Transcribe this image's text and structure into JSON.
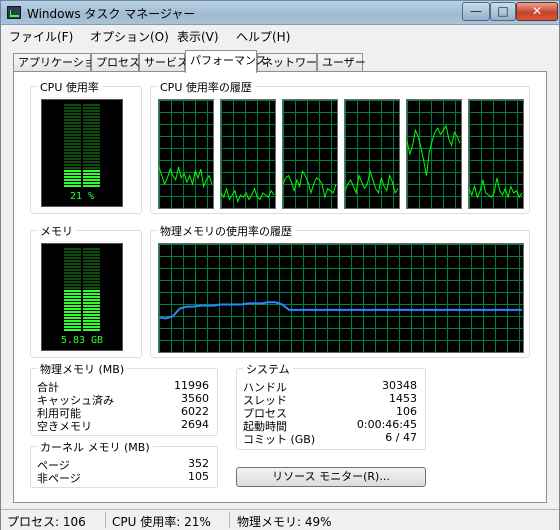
{
  "window": {
    "title": "Windows タスク マネージャー",
    "close_glyph": "✕",
    "minimize_glyph": "—",
    "maximize_glyph": "□"
  },
  "menu": [
    "ファイル(F)",
    "オプション(O)",
    "表示(V)",
    "ヘルプ(H)"
  ],
  "tabs": [
    {
      "label": "アプリケーション",
      "active": false
    },
    {
      "label": "プロセス",
      "active": false
    },
    {
      "label": "サービス",
      "active": false
    },
    {
      "label": "パフォーマンス",
      "active": true
    },
    {
      "label": "ネットワーク",
      "active": false
    },
    {
      "label": "ユーザー",
      "active": false
    }
  ],
  "cpu": {
    "title": "CPU 使用率",
    "value_label": "21 %",
    "usage_percent": 21
  },
  "cpu_history": {
    "title": "CPU 使用率の履歴",
    "cores": [
      [
        38,
        30,
        22,
        28,
        36,
        30,
        26,
        38,
        28,
        32,
        24,
        30,
        22,
        34,
        28,
        36,
        20,
        26,
        30,
        22
      ],
      [
        14,
        10,
        18,
        8,
        12,
        16,
        6,
        12,
        10,
        14,
        8,
        12,
        18,
        10,
        8,
        14,
        12,
        10,
        16,
        12
      ],
      [
        22,
        28,
        30,
        24,
        16,
        26,
        20,
        34,
        30,
        24,
        14,
        22,
        28,
        26,
        22,
        10,
        18,
        16,
        14,
        22
      ],
      [
        16,
        22,
        26,
        20,
        14,
        30,
        24,
        18,
        22,
        34,
        26,
        18,
        14,
        28,
        20,
        16,
        30,
        24,
        14,
        18
      ],
      [
        62,
        50,
        58,
        72,
        66,
        56,
        44,
        30,
        52,
        62,
        70,
        74,
        68,
        72,
        76,
        64,
        58,
        70,
        66,
        60
      ],
      [
        18,
        12,
        20,
        10,
        16,
        26,
        14,
        12,
        10,
        14,
        28,
        16,
        12,
        18,
        10,
        20,
        14,
        16,
        10,
        14
      ]
    ]
  },
  "memory": {
    "title": "メモリ",
    "value_label": "5.83 GB",
    "usage_percent": 49
  },
  "memory_history": {
    "title": "物理メモリの使用率の履歴",
    "values": [
      32,
      31,
      33,
      40,
      42,
      42,
      43,
      43,
      43,
      44,
      44,
      44,
      44,
      45,
      45,
      45,
      46,
      46,
      44,
      39,
      39,
      39,
      39,
      39,
      39,
      39,
      39,
      39,
      39,
      39,
      39,
      39,
      39,
      39,
      39,
      39,
      39,
      39,
      39,
      39,
      39,
      39,
      39,
      39,
      39,
      39,
      39,
      39,
      39,
      39,
      39,
      39,
      39,
      39
    ]
  },
  "physical_memory": {
    "title": "物理メモリ (MB)",
    "rows": [
      {
        "label": "合計",
        "value": "11996"
      },
      {
        "label": "キャッシュ済み",
        "value": "3560"
      },
      {
        "label": "利用可能",
        "value": "6022"
      },
      {
        "label": "空きメモリ",
        "value": "2694"
      }
    ]
  },
  "kernel_memory": {
    "title": "カーネル メモリ (MB)",
    "rows": [
      {
        "label": "ページ",
        "value": "352"
      },
      {
        "label": "非ページ",
        "value": "105"
      }
    ]
  },
  "system": {
    "title": "システム",
    "rows": [
      {
        "label": "ハンドル",
        "value": "30348"
      },
      {
        "label": "スレッド",
        "value": "1453"
      },
      {
        "label": "プロセス",
        "value": "106"
      },
      {
        "label": "起動時間",
        "value": "0:00:46:45"
      },
      {
        "label": "コミット (GB)",
        "value": "6 / 47"
      }
    ]
  },
  "resource_monitor_button": "リソース モニター(R)...",
  "status": {
    "processes": "プロセス: 106",
    "cpu": "CPU 使用率: 21%",
    "memory": "物理メモリ: 49%"
  },
  "colors": {
    "graph_green": "#00ff00",
    "grid_green": "#008040",
    "memory_line": "#2e86ff",
    "meter_on": "#2cff2c",
    "meter_off": "#0f4a0f"
  }
}
